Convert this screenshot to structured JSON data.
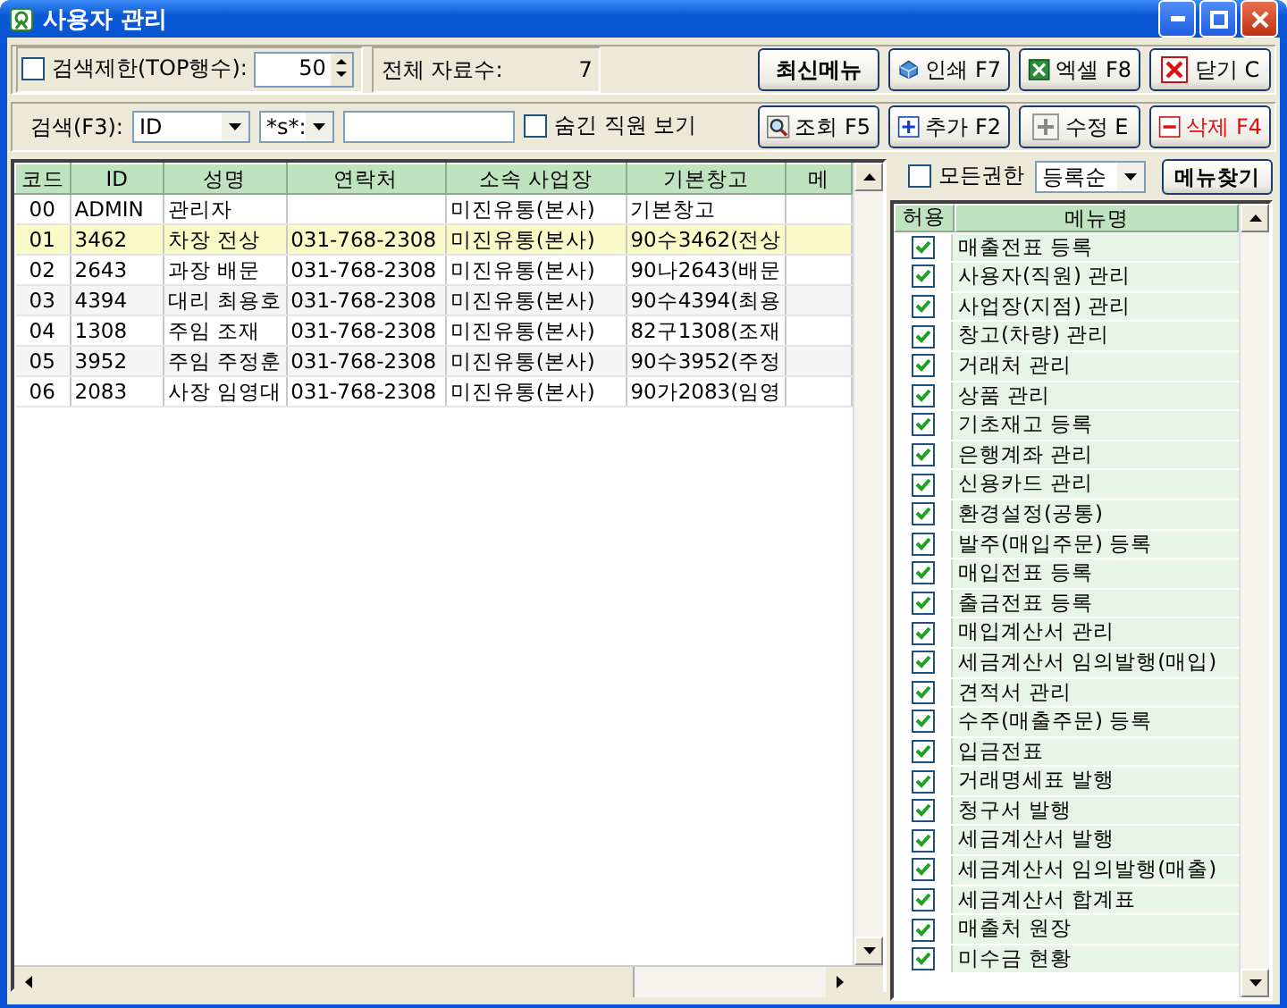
{
  "window": {
    "title": "사용자 관리"
  },
  "toolbar": {
    "limit": {
      "label": "검색제한(TOP행수):",
      "checked": false,
      "value": "50"
    },
    "total": {
      "label": "전체 자료수:",
      "value": "7"
    },
    "buttons": [
      {
        "kind": "refresh",
        "label": "최신메뉴"
      },
      {
        "kind": "print",
        "label": "인쇄 F7"
      },
      {
        "kind": "excel",
        "label": "엑셀 F8"
      },
      {
        "kind": "close",
        "label": "닫기 C"
      }
    ]
  },
  "search": {
    "label": "검색(F3):",
    "field": "ID",
    "match": "*s*:",
    "hidden_staff": {
      "label": "숨긴 직원 보기",
      "checked": false
    },
    "buttons": [
      {
        "kind": "search",
        "label": "조회 F5"
      },
      {
        "kind": "add",
        "label": "추가 F2"
      },
      {
        "kind": "edit",
        "label": "수정 E"
      },
      {
        "kind": "delete",
        "label": "삭제 F4"
      }
    ]
  },
  "grid": {
    "columns": [
      "코드",
      "ID",
      "성명",
      "연락처",
      "소속 사업장",
      "기본창고",
      "메"
    ],
    "rows": [
      {
        "cells": [
          "00",
          "ADMIN",
          "관리자",
          "",
          "미진유통(본사)",
          "기본창고",
          ""
        ],
        "selected": false
      },
      {
        "cells": [
          "01",
          "3462",
          "차장 전상",
          "031-768-2308",
          "미진유통(본사)",
          "90수3462(전상",
          ""
        ],
        "selected": true
      },
      {
        "cells": [
          "02",
          "2643",
          "과장 배문",
          "031-768-2308",
          "미진유통(본사)",
          "90나2643(배문",
          ""
        ],
        "selected": false
      },
      {
        "cells": [
          "03",
          "4394",
          "대리 최용호",
          "031-768-2308",
          "미진유통(본사)",
          "90수4394(최용",
          ""
        ],
        "selected": false
      },
      {
        "cells": [
          "04",
          "1308",
          "주임 조재",
          "031-768-2308",
          "미진유통(본사)",
          "82구1308(조재",
          ""
        ],
        "selected": false
      },
      {
        "cells": [
          "05",
          "3952",
          "주임 주정훈",
          "031-768-2308",
          "미진유통(본사)",
          "90수3952(주정",
          ""
        ],
        "selected": false
      },
      {
        "cells": [
          "06",
          "2083",
          "사장 임영대",
          "031-768-2308",
          "미진유통(본사)",
          "90가2083(임영",
          ""
        ],
        "selected": false
      }
    ]
  },
  "permissions": {
    "all": {
      "label": "모든권한",
      "checked": false
    },
    "sort": "등록순",
    "find_button": "메뉴찾기",
    "columns": [
      "허용",
      "메뉴명"
    ],
    "menus": [
      {
        "name": "매출전표 등록",
        "allowed": true
      },
      {
        "name": "사용자(직원) 관리",
        "allowed": true
      },
      {
        "name": "사업장(지점) 관리",
        "allowed": true
      },
      {
        "name": "창고(차량) 관리",
        "allowed": true
      },
      {
        "name": "거래처 관리",
        "allowed": true
      },
      {
        "name": "상품 관리",
        "allowed": true
      },
      {
        "name": "기초재고 등록",
        "allowed": true
      },
      {
        "name": "은행계좌 관리",
        "allowed": true
      },
      {
        "name": "신용카드 관리",
        "allowed": true
      },
      {
        "name": "환경설정(공통)",
        "allowed": true
      },
      {
        "name": "발주(매입주문) 등록",
        "allowed": true
      },
      {
        "name": "매입전표 등록",
        "allowed": true
      },
      {
        "name": "출금전표 등록",
        "allowed": true
      },
      {
        "name": "매입계산서 관리",
        "allowed": true
      },
      {
        "name": "세금계산서 임의발행(매입)",
        "allowed": true
      },
      {
        "name": "견적서 관리",
        "allowed": true
      },
      {
        "name": "수주(매출주문) 등록",
        "allowed": true
      },
      {
        "name": "입금전표",
        "allowed": true
      },
      {
        "name": "거래명세표 발행",
        "allowed": true
      },
      {
        "name": "청구서 발행",
        "allowed": true
      },
      {
        "name": "세금계산서 발행",
        "allowed": true
      },
      {
        "name": "세금계산서 임의발행(매출)",
        "allowed": true
      },
      {
        "name": "세금계산서 합계표",
        "allowed": true
      },
      {
        "name": "매출처 원장",
        "allowed": true
      },
      {
        "name": "미수금 현황",
        "allowed": true
      }
    ]
  }
}
